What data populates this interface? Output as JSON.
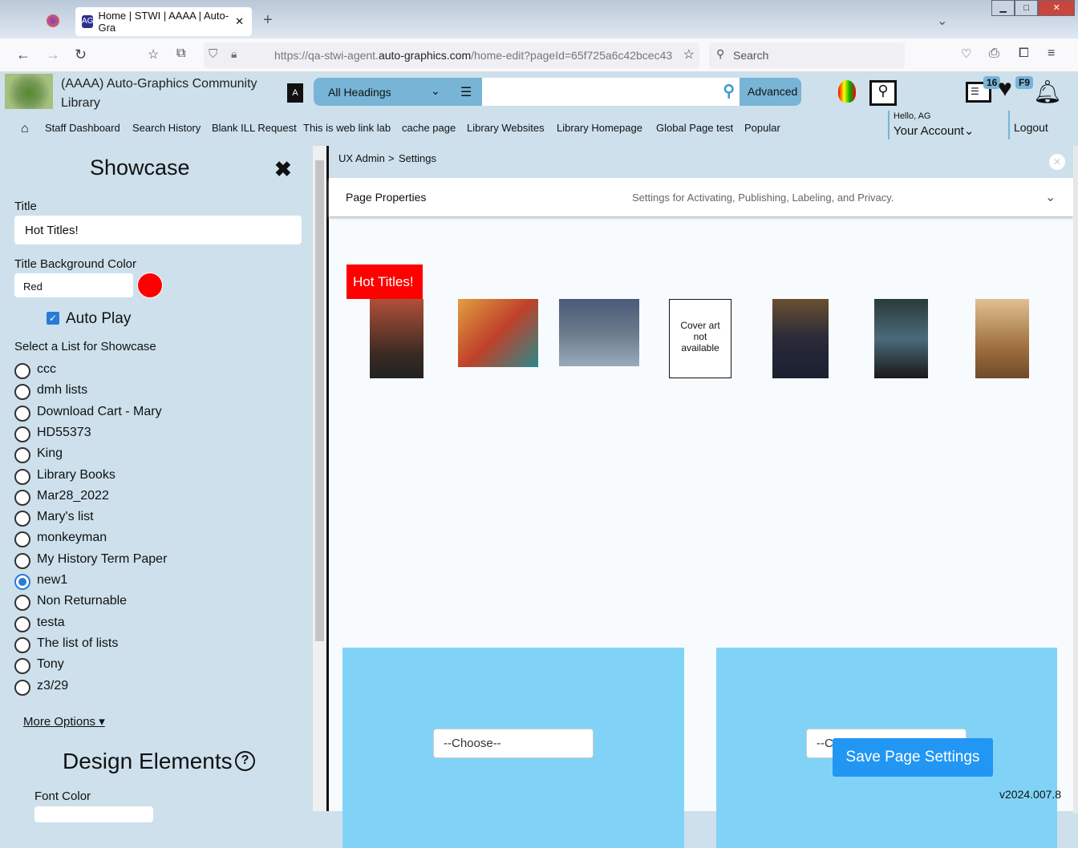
{
  "browser": {
    "tab_title": "Home | STWI | AAAA | Auto-Gra",
    "new_tab": "+",
    "url_prefix": "https://qa-stwi-agent.",
    "url_domain": "auto-graphics.com",
    "url_rest": "/home-edit?pageId=65f725a6c42bcec43",
    "search_placeholder": "Search"
  },
  "header": {
    "library_name": "(AAAA) Auto-Graphics Community Library",
    "search_scope": "All Headings",
    "advanced": "Advanced",
    "list_badge": "16",
    "heart_badge": "F9",
    "hello": "Hello, AG",
    "account": "Your Account",
    "logout": "Logout",
    "menu": [
      "Staff Dashboard",
      "Search History",
      "Blank ILL Request",
      "This is web link lab",
      "cache page",
      "Library Websites",
      "Library Homepage",
      "Global Page test",
      "Popular"
    ]
  },
  "panel": {
    "title": "Showcase",
    "title_label": "Title",
    "title_value": "Hot Titles!",
    "bg_label": "Title Background Color",
    "bg_value": "Red",
    "bg_color": "#ff0000",
    "autoplay": "Auto Play",
    "autoplay_checked": true,
    "list_label": "Select a List for Showcase",
    "lists": [
      {
        "label": "ccc"
      },
      {
        "label": "dmh lists"
      },
      {
        "label": "Download Cart - Mary"
      },
      {
        "label": "HD55373"
      },
      {
        "label": "King"
      },
      {
        "label": "Library Books"
      },
      {
        "label": "Mar28_2022"
      },
      {
        "label": "Mary's list"
      },
      {
        "label": "monkeyman"
      },
      {
        "label": "My History Term Paper"
      },
      {
        "label": "new1",
        "selected": true
      },
      {
        "label": "Non Returnable"
      },
      {
        "label": "testa"
      },
      {
        "label": "The list of lists"
      },
      {
        "label": "Tony"
      },
      {
        "label": "z3/29"
      }
    ],
    "more_options": "More Options",
    "design_title": "Design Elements",
    "font_color_label": "Font Color"
  },
  "main": {
    "breadcrumb": [
      "UX Admin",
      "Settings"
    ],
    "breadcrumb_sep": ">",
    "props_title": "Page Properties",
    "props_desc": "Settings for Activating, Publishing, Labeling, and Privacy.",
    "showcase_title": "Hot Titles!",
    "no_cover": "Cover art not available",
    "choose1": "--Choose--",
    "choose2": "--Choose--",
    "save": "Save Page Settings",
    "version": "v2024.007.8",
    "accent": "#80d3f7",
    "save_color": "#2196f3"
  }
}
